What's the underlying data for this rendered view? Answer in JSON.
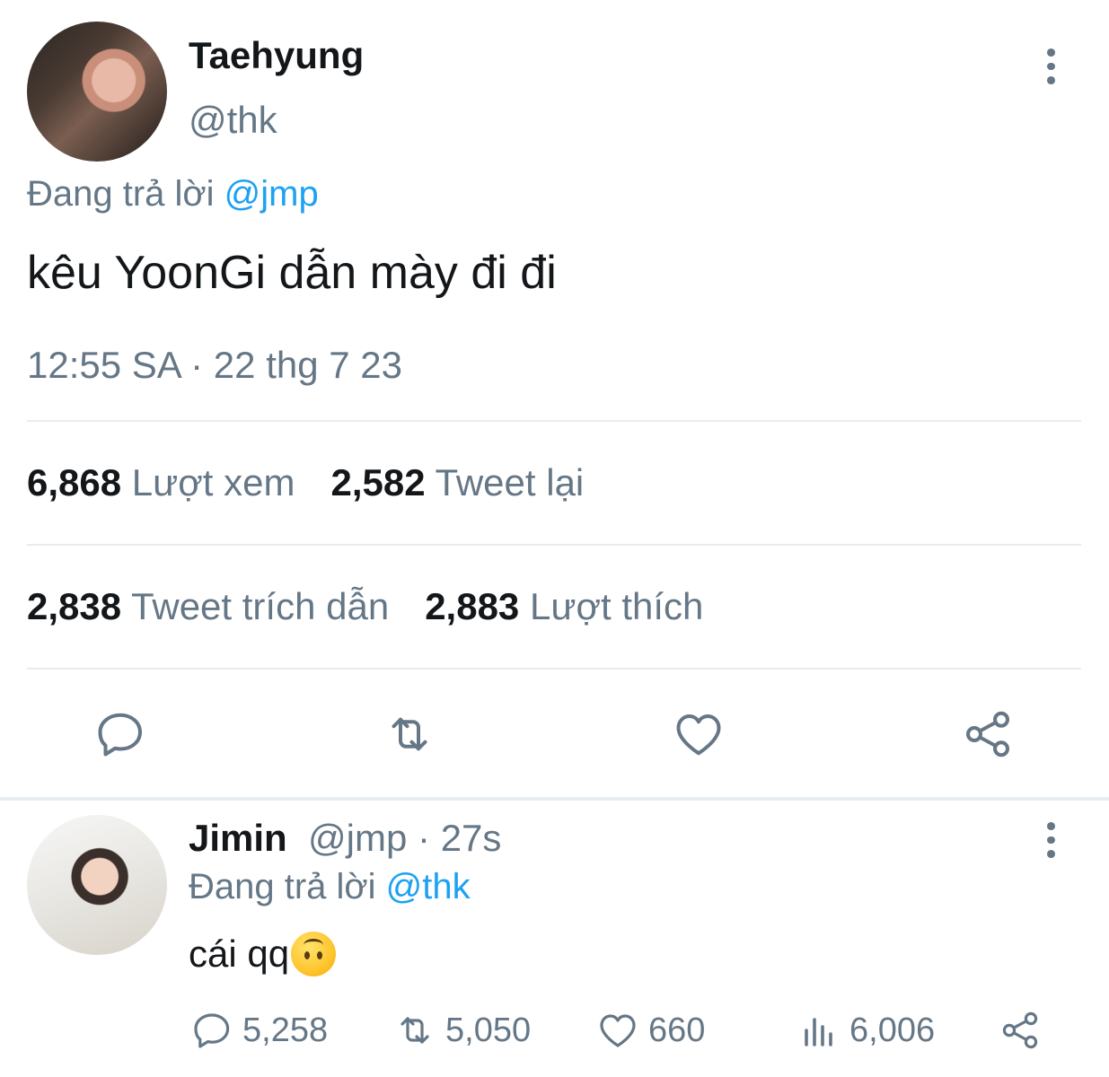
{
  "main_tweet": {
    "author_name": "Taehyung",
    "author_handle": "@thk",
    "replying_prefix": "Đang trả lời ",
    "replying_to": "@jmp",
    "text": "kêu YoonGi dẫn mày đi đi",
    "timestamp": "12:55 SA · 22 thg 7 23",
    "stats": [
      {
        "count": "6,868",
        "label": "Lượt xem"
      },
      {
        "count": "2,582",
        "label": "Tweet lại"
      },
      {
        "count": "2,838",
        "label": "Tweet trích dẫn"
      },
      {
        "count": "2,883",
        "label": "Lượt thích"
      }
    ],
    "actions": [
      "reply-icon",
      "retweet-icon",
      "like-icon",
      "share-icon"
    ]
  },
  "reply_tweet": {
    "author_name": "Jimin",
    "author_handle": "@jmp",
    "separator": " · ",
    "time": "27s",
    "replying_prefix": "Đang trả lời ",
    "replying_to": "@thk",
    "text": "cái qq",
    "emoji": "upside-down-face",
    "actions": {
      "replies": "5,258",
      "retweets": "5,050",
      "likes": "660",
      "views": "6,006"
    }
  },
  "colors": {
    "text": "#14171a",
    "muted": "#657786",
    "link": "#1da1f2",
    "divider": "#e6ecf0"
  }
}
